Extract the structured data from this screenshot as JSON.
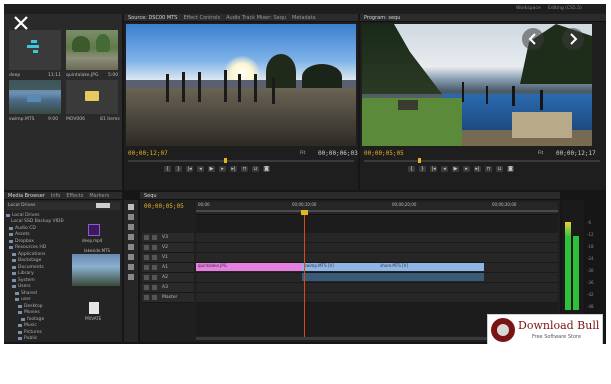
{
  "topbar": {
    "source_tab": "Source: DSC00 MTS",
    "effect_controls_tab": "Effect Controls",
    "audio_mixer_tab": "Audio Track Mixer: Sequ",
    "metadata_tab": "Metadata",
    "program_tab": "Program: sequ",
    "workspace_label": "Workspace",
    "workspace_value": "Editing (CS5.5)"
  },
  "project_thumbs": [
    {
      "name": "deep",
      "meta": "11:11"
    },
    {
      "name": "quintalake.JPG",
      "meta": "5:00"
    },
    {
      "name": "swimp.MTS",
      "meta": "9:00"
    },
    {
      "name": "MOV006",
      "meta": "81 items"
    }
  ],
  "source_monitor": {
    "timecode_in": "00;00;12;07",
    "fit": "Fit",
    "timecode_out": "00;00;06;03"
  },
  "program_monitor": {
    "timecode_in": "00;00;05;05",
    "fit": "Fit",
    "timecode_out": "00;00;12;17"
  },
  "media_browser": {
    "tabs": [
      "Media Browser",
      "Info",
      "Effects",
      "Markers"
    ],
    "filter_label": "Local Drives",
    "tree": [
      "Local Drives",
      "Local SSD Backup VIDEO",
      "Audio CD",
      "Assets",
      "Dropbox",
      "Resources HD",
      "Applications",
      "Backstage",
      "Documents",
      "Library",
      "System",
      "Users",
      "Shared",
      "user",
      "Desktop",
      "Movies",
      "footage",
      "Music",
      "Pictures",
      "Public"
    ],
    "thumbs": [
      {
        "name": "deep.mp4"
      },
      {
        "name": "lakeside.MTS"
      },
      {
        "name": "PRIVATE"
      }
    ]
  },
  "timeline": {
    "tab": "Sequ",
    "timecode": "00;00;05;05",
    "ruler": [
      "00;00",
      "00;00;10;00",
      "00;00;20;00",
      "00;00;30;00"
    ],
    "tracks": [
      "V3",
      "V2",
      "V1",
      "A1",
      "A2",
      "A3",
      "Master"
    ],
    "clips": [
      {
        "label": "quintalake.JPG"
      },
      {
        "label": "swimp.MTS [V]"
      },
      {
        "label": "shore.MTS [V]"
      }
    ]
  },
  "meters": {
    "labels": [
      "-6",
      "-12",
      "-18",
      "-24",
      "-30",
      "-36",
      "-42",
      "-48",
      "dB"
    ]
  },
  "watermark": {
    "brand": "Download Bull",
    "tagline": "Free Software Store"
  },
  "colors": {
    "pink_clip": "#e67fe0",
    "blue_clip": "#8fb5e6",
    "timecode": "#e6b422",
    "playhead": "#d84a1b",
    "meter": "#2fbf3a"
  }
}
